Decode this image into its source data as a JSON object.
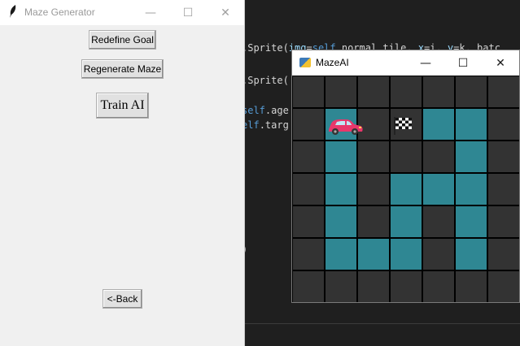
{
  "editor": {
    "lines": [
      {
        "pre": ".Sprite(",
        "kw1": "img",
        "eq": "=",
        "kw2": "self",
        "post": ".normal_tile, ",
        "p1": "x",
        "mid": "=i, ",
        "p2": "y",
        "tail": "=k, batc"
      },
      {
        "pre": ".Sprite(",
        "kw1": "",
        "eq": "",
        "kw2": "",
        "post": "",
        "p1": "",
        "mid": "",
        "p2": "",
        "tail": ""
      },
      {
        "pre": "",
        "kw1": "",
        "eq": "",
        "kw2": "self",
        "post": ".age",
        "p1": "",
        "mid": "",
        "p2": "",
        "tail": ""
      },
      {
        "pre": "",
        "kw1": "",
        "eq": "",
        "kw2": "elf",
        "post": ".targ",
        "p1": "",
        "mid": "",
        "p2": "",
        "tail": ""
      },
      {
        "pre": ")",
        "kw1": "",
        "eq": "",
        "kw2": "",
        "post": "",
        "p1": "",
        "mid": "",
        "p2": "",
        "tail": ""
      }
    ]
  },
  "generator_window": {
    "title": "Maze Generator",
    "controls": {
      "minimize": "—",
      "maximize": "☐",
      "close": "✕"
    },
    "buttons": {
      "redefine_goal": "Redefine Goal",
      "regenerate_maze": "Regenerate Maze",
      "train_ai": "Train AI",
      "back": "<-Back"
    }
  },
  "maze_window": {
    "title": "MazeAI",
    "controls": {
      "minimize": "—",
      "maximize": "☐",
      "close": "✕"
    },
    "grid": {
      "rows": 7,
      "cols": 7,
      "cells": [
        [
          0,
          0,
          0,
          0,
          0,
          0,
          0
        ],
        [
          0,
          1,
          0,
          0,
          1,
          1,
          0
        ],
        [
          0,
          1,
          0,
          0,
          0,
          1,
          0
        ],
        [
          0,
          1,
          0,
          1,
          1,
          1,
          0
        ],
        [
          0,
          1,
          0,
          1,
          0,
          1,
          0
        ],
        [
          0,
          1,
          1,
          1,
          0,
          1,
          0
        ],
        [
          0,
          0,
          0,
          0,
          0,
          0,
          0
        ]
      ],
      "agent": {
        "row": 1,
        "col": 1,
        "icon": "car-icon"
      },
      "goal": {
        "row": 1,
        "col": 3,
        "icon": "checkered-flag-icon"
      }
    },
    "colors": {
      "wall": "#333333",
      "path": "#2f8793",
      "grid_line": "#000000",
      "car_body": "#e8376b"
    }
  }
}
